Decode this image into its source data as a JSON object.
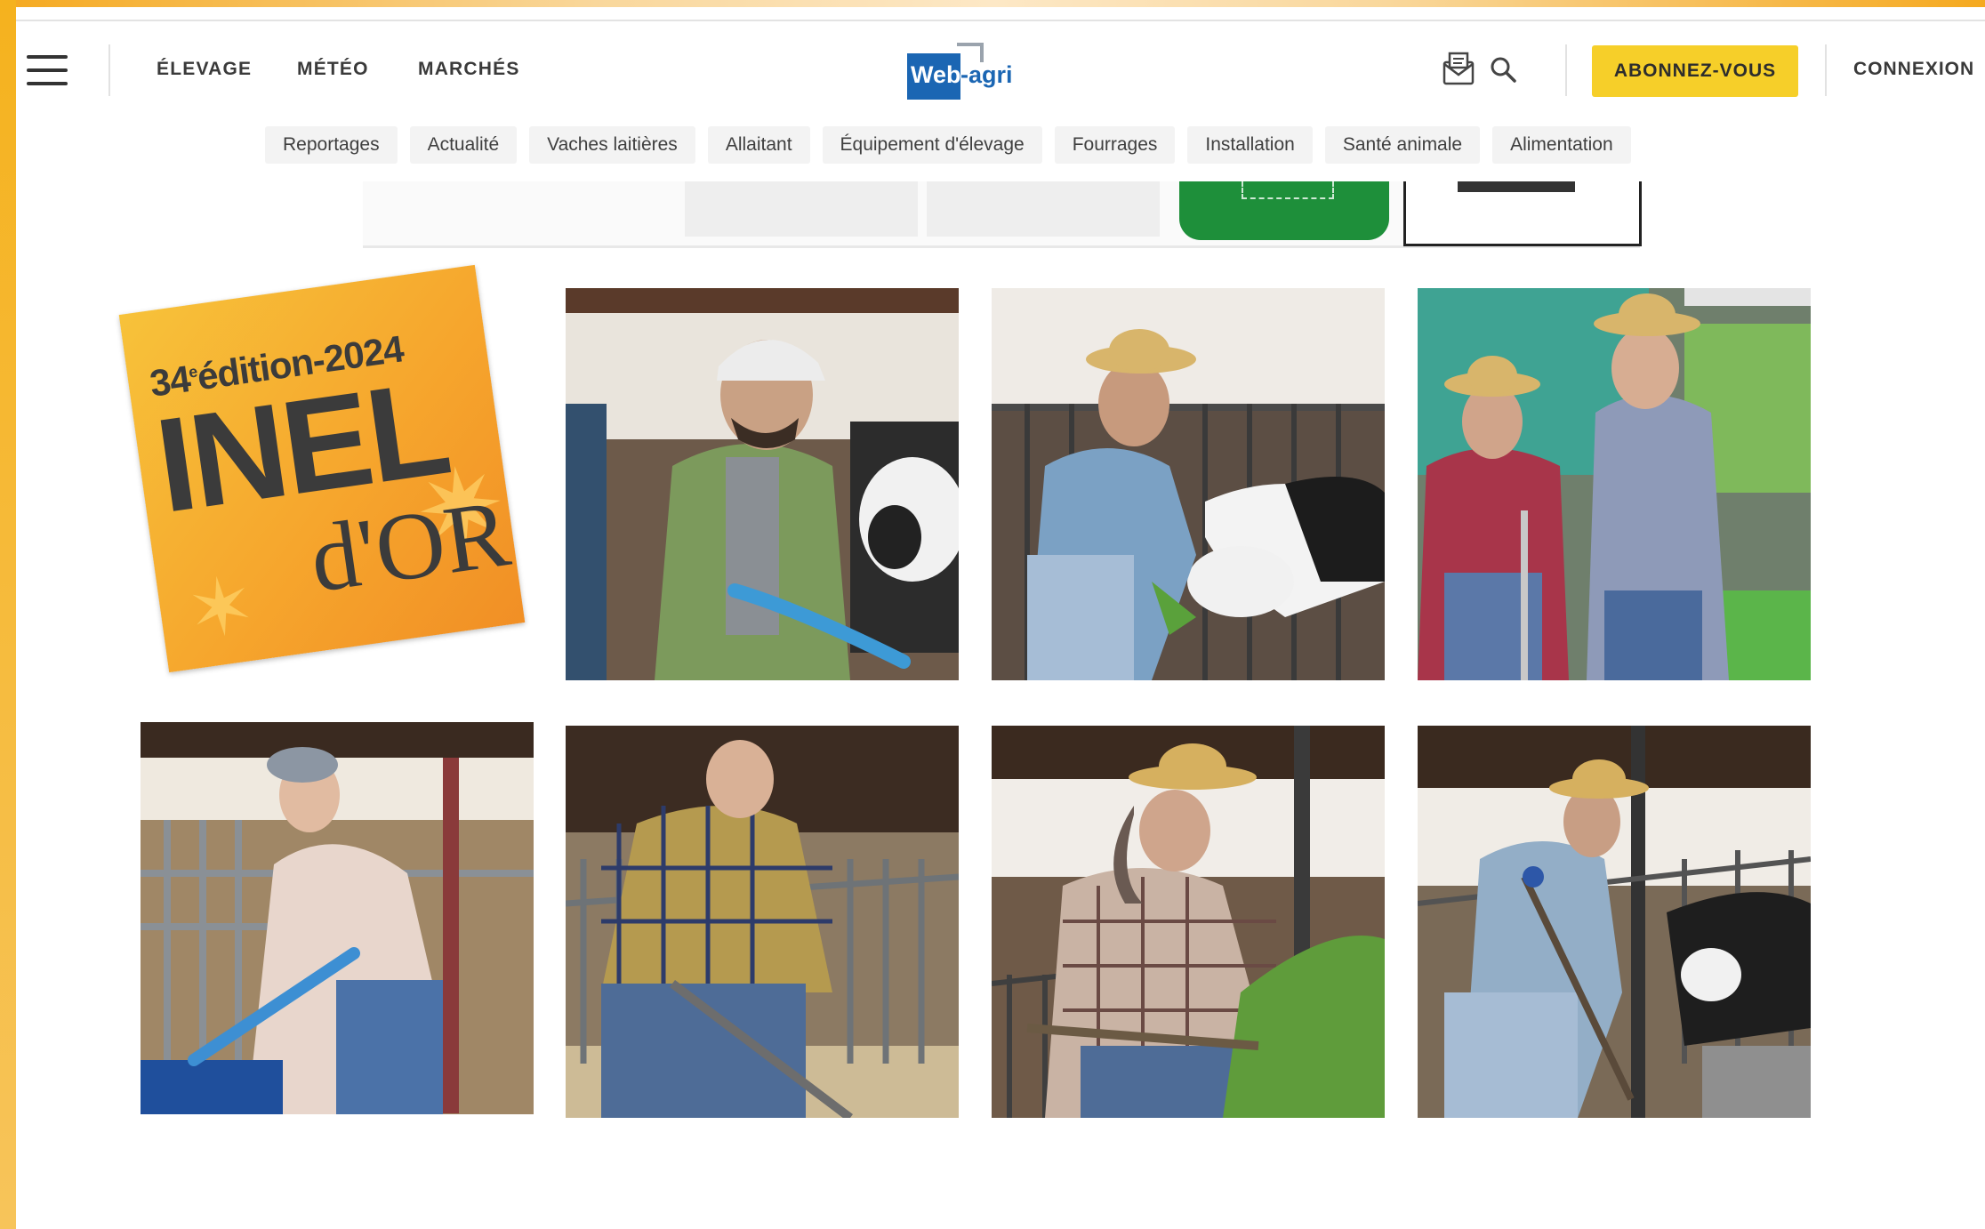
{
  "header": {
    "menu_icon": "hamburger-menu-icon",
    "nav": [
      "ÉLEVAGE",
      "MÉTÉO",
      "MARCHÉS"
    ],
    "logo": {
      "part1": "Web",
      "part2": "-agri"
    },
    "newsletter_icon": "envelope-icon",
    "search_icon": "search-icon",
    "subscribe_label": "ABONNEZ-VOUS",
    "login_label": "CONNEXION"
  },
  "subnav": [
    "Reportages",
    "Actualité",
    "Vaches laitières",
    "Allaitant",
    "Équipement d'élevage",
    "Fourrages",
    "Installation",
    "Santé animale",
    "Alimentation"
  ],
  "badge": {
    "edition_number": "34",
    "edition_sup": "e",
    "edition_text": "édition-2024",
    "title": "INEL",
    "subtitle": "d'OR"
  },
  "colors": {
    "accent": "#f6cf29",
    "frame": "#f5b21e",
    "logo_blue": "#1b66b3"
  }
}
